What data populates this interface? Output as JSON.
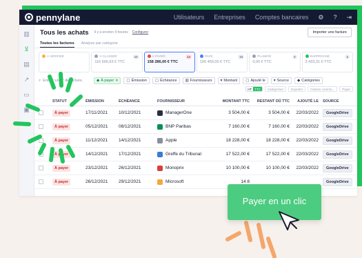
{
  "app": {
    "brand": "pennylane",
    "nav": [
      "Utilisateurs",
      "Entreprises",
      "Comptes bancaires"
    ]
  },
  "header": {
    "title": "Tous les achats",
    "meta": "Il y a environ 4 heures",
    "configure": "Configurer",
    "import_label": "Importer une facture"
  },
  "tabs": [
    {
      "label": "Toutes les factures",
      "active": true
    },
    {
      "label": "Analyse par catégorie",
      "active": false
    }
  ],
  "status_cards": [
    {
      "label": "À VÉRIFIER",
      "count": "",
      "amount": "",
      "color": "#f5b14a"
    },
    {
      "label": "À CLASSER",
      "count": "10",
      "amount": "116 696,63 € TTC",
      "color": "#9aa0b8"
    },
    {
      "label": "À PAYER",
      "count": "13",
      "amount": "158 286,00 € TTC",
      "color": "#e24646",
      "active": true
    },
    {
      "label": "PAYÉ",
      "count": "10",
      "amount": "100 459,00 € TTC",
      "color": "#4d7cfe"
    },
    {
      "label": "PLANIFIÉ",
      "count": "0",
      "amount": "0,00 € TTC",
      "color": "#9aa0b8"
    },
    {
      "label": "RAPPROCHÉ",
      "count": "4",
      "amount": "3 433,31 € TTC",
      "color": "#22c55e"
    }
  ],
  "filters": {
    "search_placeholder": "Entrez un n° de facture,",
    "chips": [
      "À payer",
      "Émission",
      "Échéance",
      "Fournisseurs",
      "Montant",
      "Ajouté le",
      "Source",
      "Catégories"
    ]
  },
  "options": {
    "ht": "HT",
    "ttc": "TTC",
    "categoriser": "Catégoriser",
    "exporter": "Exporter",
    "classer": "Classer comme...",
    "payer": "Payer"
  },
  "table": {
    "headers": {
      "status": "STATUT",
      "issued": "ÉMISSION",
      "due": "ÉCHÉANCE",
      "supplier": "FOURNISSEUR",
      "ttc": "MONTANT TTC",
      "rest": "RESTANT DÛ TTC",
      "added": "AJOUTÉ LE",
      "source": "SOURCE"
    },
    "rows": [
      {
        "status": "À payer",
        "issued": "17/11/2021",
        "due": "10/12/2021",
        "supplier": "ManagerOne",
        "ttc": "3 504,00 €",
        "rest": "3 504,00 €",
        "added": "22/03/2022",
        "source": "GoogleDrive",
        "logo": "#2a2e45"
      },
      {
        "status": "À payer",
        "issued": "05/12/2021",
        "due": "08/12/2021",
        "supplier": "BNP Paribas",
        "ttc": "7 160,00 €",
        "rest": "7 160,00 €",
        "added": "22/03/2022",
        "source": "GoogleDrive",
        "logo": "#0b8f5a"
      },
      {
        "status": "À payer",
        "issued": "11/12/2021",
        "due": "14/12/2021",
        "supplier": "Apple",
        "ttc": "18 228,00 €",
        "rest": "18 228,00 €",
        "added": "22/03/2022",
        "source": "GoogleDrive",
        "logo": "#8a8f9c"
      },
      {
        "status": "À payer",
        "issued": "14/12/2021",
        "due": "17/12/2021",
        "supplier": "Greffe du Tribunal",
        "ttc": "17 522,00 €",
        "rest": "17 522,00 €",
        "added": "22/03/2022",
        "source": "GoogleDrive",
        "logo": "#3a7bd5"
      },
      {
        "status": "À payer",
        "issued": "23/12/2021",
        "due": "26/12/2021",
        "supplier": "Monoprix",
        "ttc": "10 100,00 €",
        "rest": "10 100,00 €",
        "added": "22/03/2022",
        "source": "GoogleDrive",
        "logo": "#d6403a"
      },
      {
        "status": "À payer",
        "issued": "26/12/2021",
        "due": "29/12/2021",
        "supplier": "Microsoft",
        "ttc": "14 8",
        "rest": "",
        "added": "",
        "source": "GoogleDrive",
        "logo": "#f2a93b"
      }
    ]
  },
  "cta": {
    "label": "Payer en un clic"
  },
  "colors": {
    "accent": "#22c55e",
    "navy": "#151a33",
    "cta": "#4ccc80",
    "ray_orange": "#f5a66b"
  }
}
